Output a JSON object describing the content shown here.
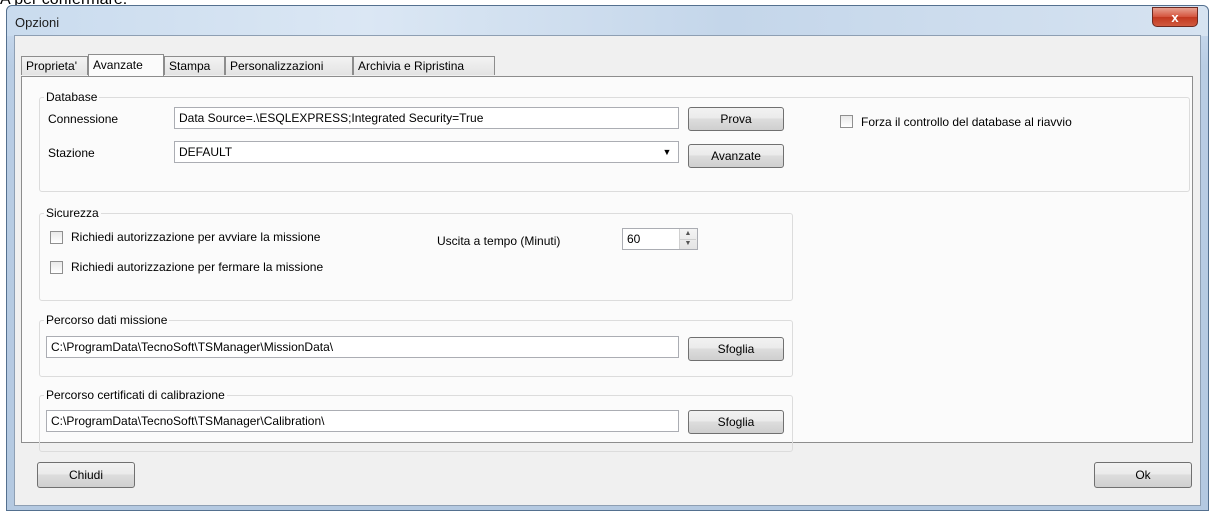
{
  "background_text": "A per confermare.",
  "window": {
    "title": "Opzioni",
    "close_symbol": "x"
  },
  "tabs": [
    {
      "label": "Proprieta'",
      "active": false
    },
    {
      "label": "Avanzate",
      "active": true
    },
    {
      "label": "Stampa",
      "active": false
    },
    {
      "label": "Personalizzazioni",
      "active": false
    },
    {
      "label": "Archivia e Ripristina",
      "active": false
    }
  ],
  "database": {
    "title": "Database",
    "connection_label": "Connessione",
    "connection_value": "Data Source=.\\ESQLEXPRESS;Integrated Security=True",
    "test_button": "Prova",
    "station_label": "Stazione",
    "station_value": "DEFAULT",
    "advanced_button": "Avanzate",
    "force_check_label": "Forza il controllo del database al riavvio",
    "force_check_checked": false
  },
  "security": {
    "title": "Sicurezza",
    "require_start_label": "Richiedi autorizzazione per avviare la missione",
    "require_start_checked": false,
    "require_stop_label": "Richiedi autorizzazione per fermare la missione",
    "require_stop_checked": false,
    "timeout_label": "Uscita a tempo (Minuti)",
    "timeout_value": "60"
  },
  "mission_path": {
    "title": "Percorso dati missione",
    "value": "C:\\ProgramData\\TecnoSoft\\TSManager\\MissionData\\",
    "browse_button": "Sfoglia"
  },
  "calibration_path": {
    "title": "Percorso certificati di calibrazione",
    "value": "C:\\ProgramData\\TecnoSoft\\TSManager\\Calibration\\",
    "browse_button": "Sfoglia"
  },
  "footer": {
    "close_button": "Chiudi",
    "ok_button": "Ok"
  },
  "icons": {
    "combo_arrow": "▼",
    "spin_up": "▲",
    "spin_down": "▼"
  }
}
